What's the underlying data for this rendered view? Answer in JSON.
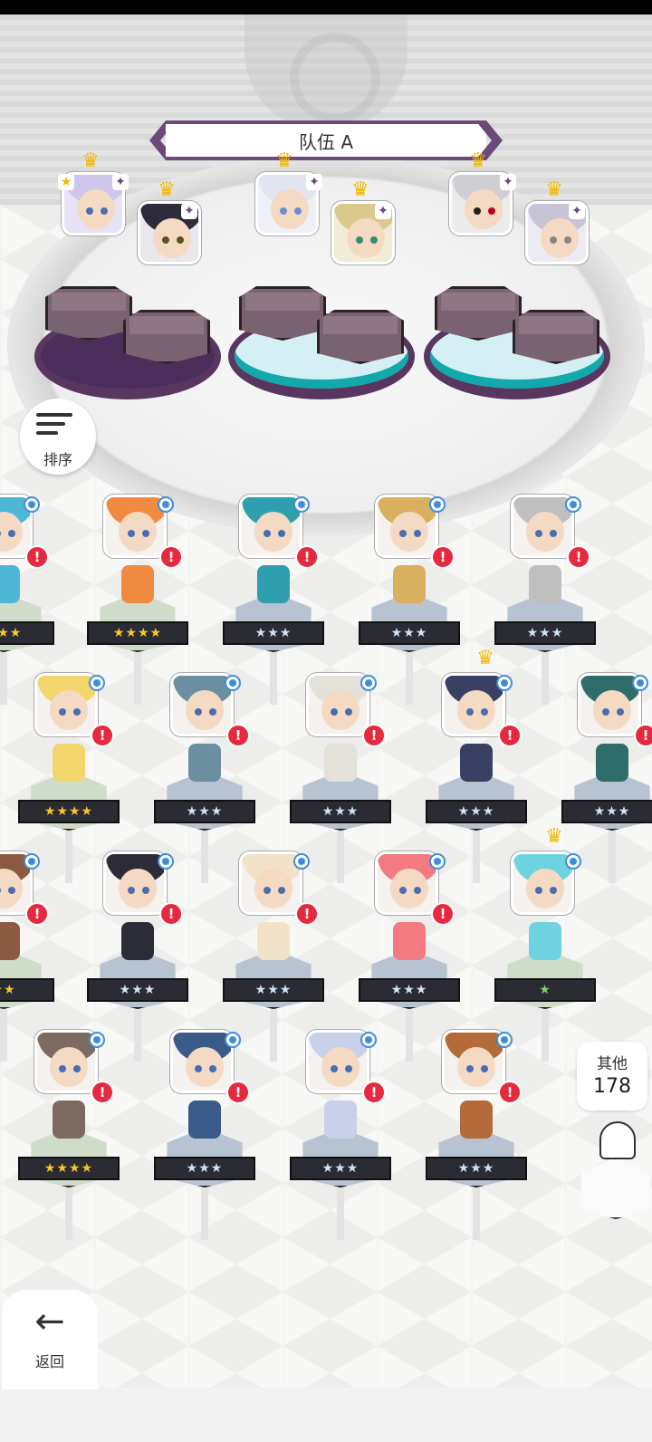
{
  "team": {
    "title": "队伍 A"
  },
  "sort_button": {
    "label": "排序"
  },
  "back_button": {
    "label": "返回"
  },
  "others": {
    "label": "其他",
    "count": "178"
  },
  "colors": {
    "alert": "#e5293f",
    "badge": "#3a8de0",
    "crown": "#f5b800",
    "team_purple": "#6b4a7a"
  },
  "team_slots": [
    {
      "base": "purple"
    },
    {
      "base": "cyan"
    },
    {
      "base": "cyan"
    }
  ],
  "heroes": [
    {
      "stars": "★★★★",
      "tier": "gold"
    },
    {
      "stars": "★★★",
      "tier": "silver"
    },
    {
      "stars": "★★★",
      "tier": "silver"
    },
    {
      "stars": "★★★",
      "tier": "silver"
    },
    {
      "stars": "★★★★",
      "tier": "gold"
    },
    {
      "stars": "★★★",
      "tier": "silver"
    },
    {
      "stars": "★★★",
      "tier": "silver"
    },
    {
      "stars": "★★★",
      "tier": "silver"
    },
    {
      "stars": "★★★",
      "tier": "silver"
    },
    {
      "stars": "★★★",
      "tier": "silver"
    },
    {
      "stars": "★★★",
      "tier": "silver"
    },
    {
      "stars": "★★★",
      "tier": "silver"
    },
    {
      "stars": "★",
      "tier": "green"
    },
    {
      "stars": "★★★★",
      "tier": "gold"
    },
    {
      "stars": "★★★",
      "tier": "silver"
    },
    {
      "stars": "★★★",
      "tier": "silver"
    },
    {
      "stars": "★★★",
      "tier": "silver"
    }
  ]
}
